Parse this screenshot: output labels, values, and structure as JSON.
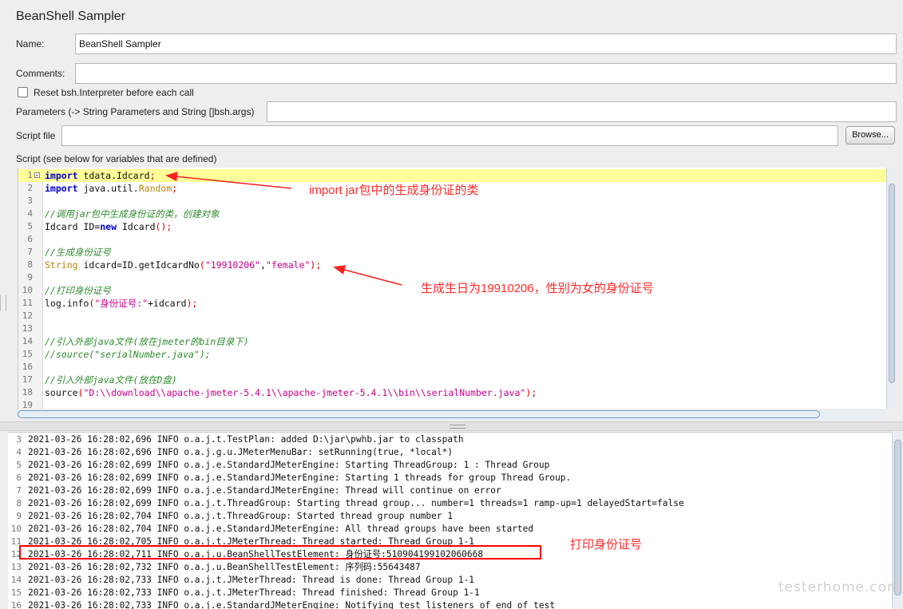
{
  "panel": {
    "title": "BeanShell Sampler",
    "name_label": "Name:",
    "name_value": "BeanShell Sampler",
    "comments_label": "Comments:",
    "comments_value": "",
    "reset_label": "Reset bsh.Interpreter before each call",
    "reset_checked": false,
    "parameters_label": "Parameters (-> String Parameters and String []bsh.args)",
    "parameters_value": "",
    "script_file_label": "Script file",
    "script_file_value": "",
    "browse_label": "Browse...",
    "script_label": "Script (see below for variables that are defined)"
  },
  "script": {
    "highlighted_line": 1,
    "lines": [
      {
        "n": "1",
        "t": "import tdata.Idcard;"
      },
      {
        "n": "2",
        "t": "import java.util.Random;"
      },
      {
        "n": "3",
        "t": ""
      },
      {
        "n": "4",
        "t": "//调用jar包中生成身份证的类，创建对象"
      },
      {
        "n": "5",
        "t": "Idcard ID=new Idcard();"
      },
      {
        "n": "6",
        "t": ""
      },
      {
        "n": "7",
        "t": "//生成身份证号"
      },
      {
        "n": "8",
        "t": "String idcard=ID.getIdcardNo(\"19910206\",\"female\");"
      },
      {
        "n": "9",
        "t": ""
      },
      {
        "n": "10",
        "t": "//打印身份证号"
      },
      {
        "n": "11",
        "t": "log.info(\"身份证号:\"+idcard);"
      },
      {
        "n": "12",
        "t": ""
      },
      {
        "n": "13",
        "t": ""
      },
      {
        "n": "14",
        "t": "//引入外部java文件(放在jmeter的bin目录下)"
      },
      {
        "n": "15",
        "t": "//source(\"serialNumber.java\");"
      },
      {
        "n": "16",
        "t": ""
      },
      {
        "n": "17",
        "t": "//引入外部java文件(放在D盘)"
      },
      {
        "n": "18",
        "t": "source(\"D:\\\\download\\\\apache-jmeter-5.4.1\\\\apache-jmeter-5.4.1\\\\bin\\\\serialNumber.java\");"
      },
      {
        "n": "19",
        "t": ""
      }
    ]
  },
  "log": {
    "lines": [
      {
        "n": "3",
        "t": "2021-03-26 16:28:02,696 INFO o.a.j.t.TestPlan: added D:\\jar\\pwhb.jar to classpath"
      },
      {
        "n": "4",
        "t": "2021-03-26 16:28:02,696 INFO o.a.j.g.u.JMeterMenuBar: setRunning(true, *local*)"
      },
      {
        "n": "5",
        "t": "2021-03-26 16:28:02,699 INFO o.a.j.e.StandardJMeterEngine: Starting ThreadGroup: 1 : Thread Group"
      },
      {
        "n": "6",
        "t": "2021-03-26 16:28:02,699 INFO o.a.j.e.StandardJMeterEngine: Starting 1 threads for group Thread Group."
      },
      {
        "n": "7",
        "t": "2021-03-26 16:28:02,699 INFO o.a.j.e.StandardJMeterEngine: Thread will continue on error"
      },
      {
        "n": "8",
        "t": "2021-03-26 16:28:02,699 INFO o.a.j.t.ThreadGroup: Starting thread group... number=1 threads=1 ramp-up=1 delayedStart=false"
      },
      {
        "n": "9",
        "t": "2021-03-26 16:28:02,704 INFO o.a.j.t.ThreadGroup: Started thread group number 1"
      },
      {
        "n": "10",
        "t": "2021-03-26 16:28:02,704 INFO o.a.j.e.StandardJMeterEngine: All thread groups have been started"
      },
      {
        "n": "11",
        "t": "2021-03-26 16:28:02,705 INFO o.a.j.t.JMeterThread: Thread started: Thread Group 1-1"
      },
      {
        "n": "12",
        "t": "2021-03-26 16:28:02,711 INFO o.a.j.u.BeanShellTestElement: 身份证号:510904199102060668"
      },
      {
        "n": "13",
        "t": "2021-03-26 16:28:02,732 INFO o.a.j.u.BeanShellTestElement: 序列码:55643487"
      },
      {
        "n": "14",
        "t": "2021-03-26 16:28:02,733 INFO o.a.j.t.JMeterThread: Thread is done: Thread Group 1-1"
      },
      {
        "n": "15",
        "t": "2021-03-26 16:28:02,733 INFO o.a.j.t.JMeterThread: Thread finished: Thread Group 1-1"
      },
      {
        "n": "16",
        "t": "2021-03-26 16:28:02,733 INFO o.a.j.e.StandardJMeterEngine: Notifying test listeners of end of test"
      }
    ]
  },
  "annotations": {
    "import_note": "import  jar包中的生成身份证的类",
    "idcard_note": "生成生日为19910206，性别为女的身份证号",
    "print_note": "打印身份证号"
  },
  "watermark": "testerhome.com",
  "colors": {
    "annotation": "#ff2a2a",
    "highlight_line": "#ffff99",
    "keyword": "#0000cc",
    "comment": "#2e8b2e",
    "string": "#c8008c"
  }
}
